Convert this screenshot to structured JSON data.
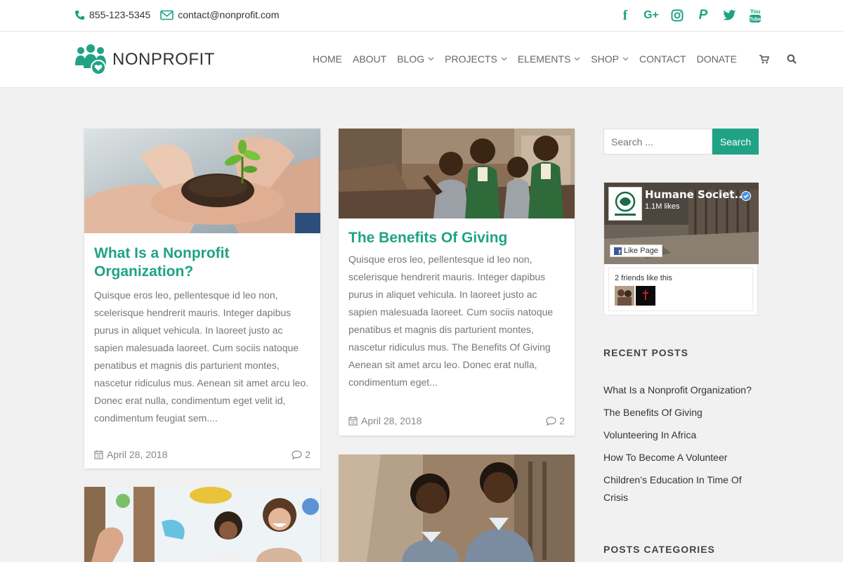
{
  "topbar": {
    "phone": "855-123-5345",
    "email": "contact@nonprofit.com",
    "social": [
      {
        "icon": "facebook-icon",
        "glyph": "f"
      },
      {
        "icon": "google-plus-icon",
        "glyph": "G+"
      },
      {
        "icon": "instagram-icon",
        "glyph": ""
      },
      {
        "icon": "paypal-icon",
        "glyph": "P"
      },
      {
        "icon": "twitter-icon",
        "glyph": ""
      },
      {
        "icon": "youtube-icon",
        "glyph": ""
      }
    ]
  },
  "header": {
    "logo_text": "NONPROFIT",
    "nav": [
      {
        "label": "HOME",
        "dropdown": false
      },
      {
        "label": "ABOUT",
        "dropdown": false
      },
      {
        "label": "BLOG",
        "dropdown": true
      },
      {
        "label": "PROJECTS",
        "dropdown": true
      },
      {
        "label": "ELEMENTS",
        "dropdown": true
      },
      {
        "label": "SHOP",
        "dropdown": true
      },
      {
        "label": "CONTACT",
        "dropdown": false
      },
      {
        "label": "DONATE",
        "dropdown": false
      }
    ]
  },
  "posts": [
    {
      "title": "What Is a Nonprofit Organization?",
      "excerpt": "Quisque eros leo, pellentesque id leo non, scelerisque hendrerit mauris. Integer dapibus purus in aliquet vehicula. In laoreet justo ac sapien malesuada laoreet. Cum sociis natoque penatibus et magnis dis parturient montes, nascetur ridiculus mus. Aenean sit amet arcu leo. Donec erat nulla, condimentum eget velit id, condimentum feugiat sem....",
      "date": "April 28, 2018",
      "comments": "2"
    },
    {
      "title": "The Benefits Of Giving",
      "excerpt": "Quisque eros leo, pellentesque id leo non, scelerisque hendrerit mauris. Integer dapibus purus in aliquet vehicula. In laoreet justo ac sapien malesuada laoreet. Cum sociis natoque penatibus et magnis dis parturient montes, nascetur ridiculus mus. The Benefits Of Giving Aenean sit amet arcu leo. Donec erat nulla, condimentum eget...",
      "date": "April 28, 2018",
      "comments": "2"
    }
  ],
  "sidebar": {
    "search_placeholder": "Search ...",
    "search_button": "Search",
    "fb": {
      "page_name": "Humane Societ...",
      "likes": "1.1M likes",
      "like_button": "Like Page",
      "friends_text": "2 friends like this"
    },
    "recent_title": "RECENT POSTS",
    "recent_posts": [
      "What Is a Nonprofit Organization?",
      "The Benefits Of Giving",
      "Volunteering In Africa",
      "How To Become A Volunteer",
      "Children’s Education In Time Of Crisis"
    ],
    "categories_title": "POSTS CATEGORIES"
  },
  "colors": {
    "accent": "#1fa384",
    "background": "#f1f1f1"
  }
}
